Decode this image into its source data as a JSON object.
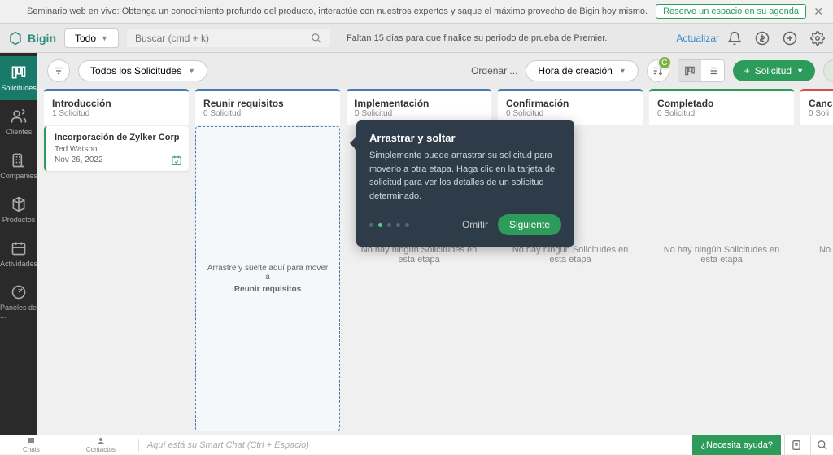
{
  "banner": {
    "text": "Seminario web en vivo: Obtenga un conocimiento profundo del producto, interactúe con nuestros expertos y saque el máximo provecho de Bigin hoy mismo.",
    "button": "Reserve un espacio en su agenda"
  },
  "topbar": {
    "brand": "Bigin",
    "scope": "Todo",
    "search_placeholder": "Buscar (cmd + k)",
    "trial_text": "Faltan 15 días para que finalice su período de prueba de Premier.",
    "upgrade": "Actualizar"
  },
  "sidebar": {
    "items": [
      {
        "label": "Solicitudes"
      },
      {
        "label": "Clientes"
      },
      {
        "label": "Companies"
      },
      {
        "label": "Productos"
      },
      {
        "label": "Actividades"
      },
      {
        "label": "Paneles de ..."
      }
    ]
  },
  "toolbar": {
    "filter_label": "Todos los Solicitudes",
    "sort_label": "Ordenar ...",
    "sort_value": "Hora de creación",
    "add_label": "Solicitud",
    "avatar_initial": "C"
  },
  "columns": [
    {
      "title": "Introducción",
      "sub": "1 Solicitud"
    },
    {
      "title": "Reunir requisitos",
      "sub": "0 Solicitud"
    },
    {
      "title": "Implementación",
      "sub": "0 Solicitud"
    },
    {
      "title": "Confirmación",
      "sub": "0 Solicitud"
    },
    {
      "title": "Completado",
      "sub": "0 Solicitud"
    },
    {
      "title": "Canc",
      "sub": "0 Soli"
    }
  ],
  "card": {
    "title": "Incorporación de Zylker Corp",
    "contact": "Ted Watson",
    "date": "Nov 26, 2022"
  },
  "dropzone": {
    "text": "Arrastre y suelte aquí para mover a",
    "target": "Reunir requisitos"
  },
  "empty_text": "No hay ningún Solicitudes en esta etapa",
  "empty_text_short": "No",
  "tooltip": {
    "title": "Arrastrar y soltar",
    "body": "Simplemente puede arrastrar su solicitud para moverlo a otra etapa. Haga clic en la tarjeta de solicitud para ver los detalles de un solicitud determinado.",
    "skip": "Omitir",
    "next": "Siguiente"
  },
  "bottombar": {
    "chats": "Chats",
    "contacts": "Contactos",
    "placeholder": "Aquí está su Smart Chat (Ctrl + Espacio)",
    "help": "¿Necesita ayuda?"
  }
}
